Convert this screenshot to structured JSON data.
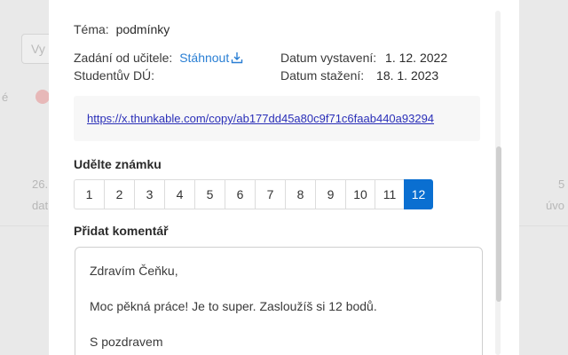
{
  "background": {
    "search_placeholder": "Vy",
    "frag_left_1": "é",
    "frag_left_2": "26.",
    "frag_left_3": "dat",
    "frag_right_1": "5",
    "frag_right_2": "úvo"
  },
  "modal": {
    "topic_label": "Téma:",
    "topic_value": "podmínky",
    "assignment_label": "Zadání od učitele:",
    "download_link": "Stáhnout",
    "student_hw_label": "Studentův DÚ:",
    "issued_label": "Datum vystavení:",
    "issued_value": "1. 12. 2022",
    "downloaded_label": "Datum stažení:",
    "downloaded_value": "18. 1. 2023",
    "url": "https://x.thunkable.com/copy/ab177dd45a80c9f71c6faab440a93294",
    "grade_heading": "Udělte známku",
    "grades": [
      "1",
      "2",
      "3",
      "4",
      "5",
      "6",
      "7",
      "8",
      "9",
      "10",
      "11",
      "12"
    ],
    "selected_grade": "12",
    "comment_heading": "Přidat komentář",
    "comment_lines": [
      "Zdravím Čeňku,",
      "Moc pěkná práce! Je to super. Zasloužíš si 12 bodů.",
      "S pozdravem"
    ]
  },
  "colors": {
    "accent": "#0a6fd1",
    "link": "#2a7fd4",
    "url": "#2a2fb8"
  },
  "icons": {
    "download": "download-icon"
  }
}
